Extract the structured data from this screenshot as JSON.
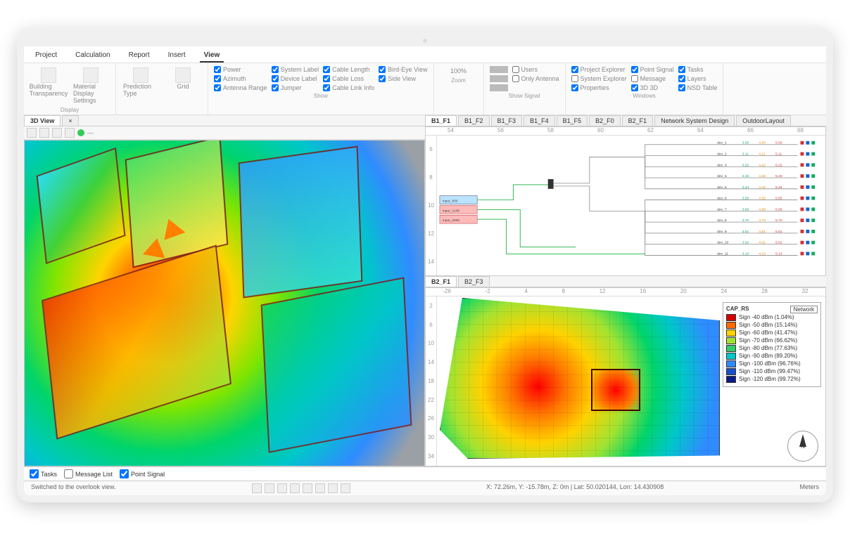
{
  "menu": {
    "items": [
      "Project",
      "Calculation",
      "Report",
      "Insert",
      "View"
    ],
    "active": "View"
  },
  "ribbon": {
    "display": {
      "title": "Display",
      "btn1": "Building Transparency",
      "btn2": "Material Display Settings"
    },
    "prediction": {
      "title": "",
      "btn": "Prediction Type",
      "grid": "Grid"
    },
    "show": {
      "title": "Show",
      "c1": [
        "Power",
        "Azimuth",
        "Antenna Range"
      ],
      "c2": [
        "System Label",
        "Device Label",
        "Jumper"
      ],
      "c3": [
        "Cable Length",
        "Cable Loss",
        "Cable Link Info"
      ],
      "c4": [
        "Bird-Eye View",
        "Side View"
      ]
    },
    "zoom": {
      "title": "Zoom",
      "value": "100%"
    },
    "signal": {
      "title": "Show Signal",
      "c": [
        "Users",
        "Only Antenna"
      ]
    },
    "windows": {
      "title": "Windows",
      "c1": [
        "Project Explorer",
        "System Explorer",
        "Properties"
      ],
      "c2": [
        "Point Signal",
        "Message",
        "3D 3D"
      ],
      "c3": [
        "Tasks",
        "Layers",
        "NSD Table"
      ]
    }
  },
  "leftTabs": {
    "main": "3D View"
  },
  "rightTop": {
    "tabs": [
      "B1_F1",
      "B1_F2",
      "B1_F3",
      "B1_F4",
      "B1_F5",
      "B2_F0",
      "B2_F1",
      "Network System Design",
      "OutdoorLayout"
    ],
    "active": "B1_F1",
    "rulerTop": [
      "54",
      "56",
      "58",
      "60",
      "62",
      "64",
      "66",
      "68"
    ],
    "rulerLeft": [
      "6",
      "8",
      "10",
      "12",
      "14"
    ]
  },
  "rightBot": {
    "tabs": [
      "B2_F1",
      "B2_F3"
    ],
    "active": "B2_F1",
    "rulerTop": [
      "-26",
      "-2",
      "4",
      "8",
      "12",
      "16",
      "20",
      "24",
      "28",
      "32"
    ],
    "rulerLeft": [
      "2",
      "6",
      "10",
      "14",
      "18",
      "22",
      "26",
      "30",
      "34"
    ]
  },
  "legend": {
    "title": "CAP_RS",
    "network": "Network",
    "rows": [
      {
        "c": "#d40000",
        "t": "Sign -40 dBm  (1.04%)"
      },
      {
        "c": "#ff6a00",
        "t": "Sign -50 dBm  (15.14%)"
      },
      {
        "c": "#ffd200",
        "t": "Sign -60 dBm  (41.47%)"
      },
      {
        "c": "#a1e332",
        "t": "Sign -70 dBm  (66.62%)"
      },
      {
        "c": "#33cc66",
        "t": "Sign -80 dBm  (77.63%)"
      },
      {
        "c": "#00c7c9",
        "t": "Sign -90 dBm  (89.20%)"
      },
      {
        "c": "#2f8cff",
        "t": "Sign -100 dBm (96.76%)"
      },
      {
        "c": "#1a4fcc",
        "t": "Sign -110 dBm (99.47%)"
      },
      {
        "c": "#0a1a88",
        "t": "Sign -120 dBm (99.72%)"
      }
    ]
  },
  "bottomTabs": [
    "Tasks",
    "Message List",
    "Point Signal"
  ],
  "status": {
    "left": "Switched to the overlook view.",
    "coords": "X: 72.26m, Y: -15.78m, Z: 0m | Lat: 50.020144, Lon: 14.430908",
    "right": "Meters"
  }
}
